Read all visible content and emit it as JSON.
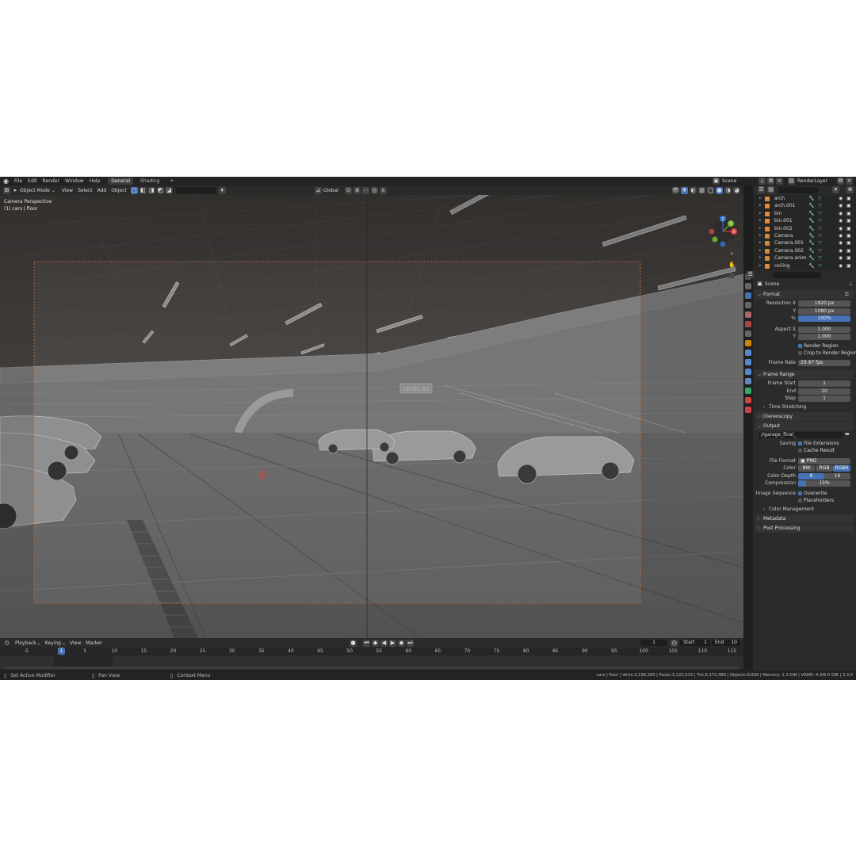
{
  "topbar": {
    "menus": [
      "File",
      "Edit",
      "Render",
      "Window",
      "Help"
    ],
    "workspaces": [
      "General",
      "Shading"
    ],
    "add_workspace": "+",
    "scene_name": "Scene",
    "view_layer": "RenderLayer"
  },
  "viewport_header": {
    "mode": "Object Mode",
    "menus": [
      "View",
      "Select",
      "Add",
      "Object"
    ],
    "orientation": "Global"
  },
  "viewport": {
    "title": "Camera Perspective",
    "subtitle": "(1) cars | floor",
    "wall_sign": "LEVEL 03",
    "gizmo": {
      "x": "X",
      "y": "Y",
      "z": "Z"
    }
  },
  "outliner": {
    "items": [
      {
        "name": "arch",
        "type": "mesh"
      },
      {
        "name": "arch.001",
        "type": "mesh"
      },
      {
        "name": "bin",
        "type": "mesh"
      },
      {
        "name": "bin.001",
        "type": "mesh"
      },
      {
        "name": "bin.002",
        "type": "mesh"
      },
      {
        "name": "Camera",
        "type": "camera"
      },
      {
        "name": "Camera.001",
        "type": "camera"
      },
      {
        "name": "Camera.002",
        "type": "camera"
      },
      {
        "name": "Camera.anim",
        "type": "camera"
      },
      {
        "name": "ceiling",
        "type": "mesh"
      }
    ]
  },
  "properties": {
    "scene": "Scene",
    "format": {
      "header": "Format",
      "resolution_x_label": "Resolution X",
      "resolution_x": "1920 px",
      "y_label": "Y",
      "resolution_y": "1080 px",
      "percent_label": "%",
      "percent": "100%",
      "aspect_x_label": "Aspect X",
      "aspect_x": "1.000",
      "aspect_y_label": "Y",
      "aspect_y": "1.000",
      "render_region": "Render Region",
      "crop_region": "Crop to Render Region",
      "frame_rate_label": "Frame Rate",
      "frame_rate": "29.97 fps"
    },
    "frame_range": {
      "header": "Frame Range",
      "start_label": "Frame Start",
      "start": "1",
      "end_label": "End",
      "end": "10",
      "step_label": "Step",
      "step": "1",
      "time_stretching": "Time Stretching"
    },
    "stereoscopy": "Stereoscopy",
    "output": {
      "header": "Output",
      "path": "//garage_final_",
      "saving_label": "Saving",
      "file_extensions": "File Extensions",
      "cache_result": "Cache Result",
      "file_format_label": "File Format",
      "file_format": "PNG",
      "color_label": "Color",
      "color_options": [
        "BW",
        "RGB",
        "RGBA"
      ],
      "color_selected": "RGBA",
      "depth_label": "Color Depth",
      "depth_options": [
        "8",
        "16"
      ],
      "depth_selected": "8",
      "compression_label": "Compression",
      "compression": "15%",
      "compression_value": 0.15,
      "image_sequence_label": "Image Sequence",
      "overwrite": "Overwrite",
      "placeholders": "Placeholders",
      "color_management": "Color Management"
    },
    "metadata": "Metadata",
    "post_processing": "Post Processing"
  },
  "timeline": {
    "menus": [
      "Playback",
      "Keying",
      "View",
      "Marker"
    ],
    "current_frame": "1",
    "start_label": "Start",
    "start": "1",
    "end_label": "End",
    "end": "10",
    "ticks": [
      "-5",
      "1",
      "5",
      "10",
      "15",
      "20",
      "25",
      "30",
      "35",
      "40",
      "45",
      "50",
      "55",
      "60",
      "65",
      "70",
      "75",
      "80",
      "85",
      "90",
      "95",
      "100",
      "105",
      "110",
      "115"
    ]
  },
  "statusbar": {
    "hint_1": "Set Active Modifier",
    "hint_2": "Pan View",
    "hint_3": "Context Menu",
    "stats": "cars | floor | Verts:3,199,300 | Faces:3,122,015 | Tris:6,172,480 | Objects:0/269 | Memory: 1.3 GiB | VRAM: 4.3/6.0 GiB | 3.3.0"
  },
  "colors": {
    "accent": "#4772b3",
    "panel": "#2b2b2b",
    "header": "#232323"
  }
}
